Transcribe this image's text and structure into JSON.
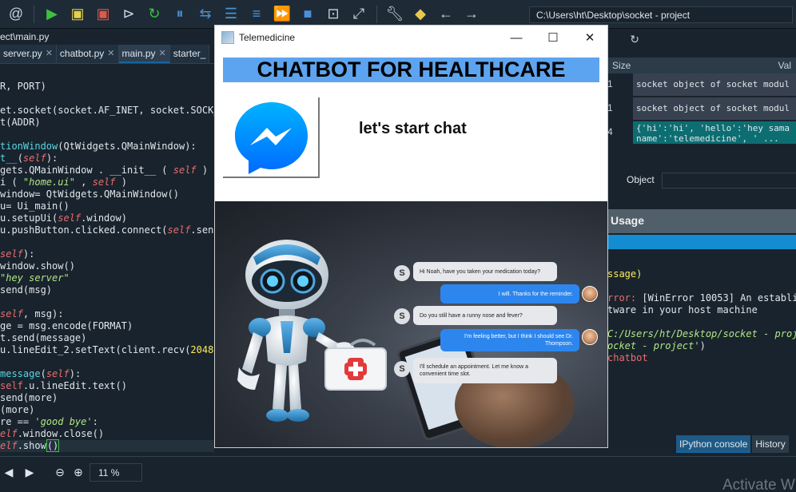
{
  "ide": {
    "path": "C:\\Users\\ht\\Desktop\\socket - project",
    "editor_title": "ect\\main.py",
    "tabs": [
      "server.py",
      "chatbot.py",
      "main.py",
      "starter_"
    ],
    "active_tab": "main.py",
    "variables": {
      "columns": [
        "Size",
        "Val"
      ],
      "rows": [
        {
          "size": "1",
          "value": "socket object of socket modul"
        },
        {
          "size": "1",
          "value": "socket object of socket modul"
        },
        {
          "size": "4",
          "value": "{'hi':'hi', 'hello':'hey sama\nname':'telemedicine', ' ..."
        }
      ]
    },
    "object_label": "Object",
    "usage_label": "Usage",
    "console_tabs": [
      "IPython console",
      "History"
    ],
    "console_active_tab": "IPython console",
    "zoom": "11 %",
    "watermark": "Activate Wi"
  },
  "telemedicine": {
    "window_title": "Telemedicine",
    "banner": "CHATBOT FOR HEALTHCARE",
    "chat_label": "let's start chat",
    "messages": [
      {
        "side": "left",
        "text": "Hi Noah, have you taken your medication today?"
      },
      {
        "side": "right",
        "text": "I will. Thanks for the reminder."
      },
      {
        "side": "left",
        "text": "Do you still have a runny nose and fever?"
      },
      {
        "side": "right",
        "text": "I'm feeling better, but I think I should see Dr. Thompson."
      },
      {
        "side": "left",
        "text": "I'll schedule an appointment. Let me know a convenient time slot."
      }
    ],
    "badge_letter": "S"
  },
  "colors": {
    "banner_blue": "#5da4f0",
    "ide_bg": "#19232d",
    "bubble_blue": "#2d86ee",
    "messenger_blue": "#0084ff"
  }
}
